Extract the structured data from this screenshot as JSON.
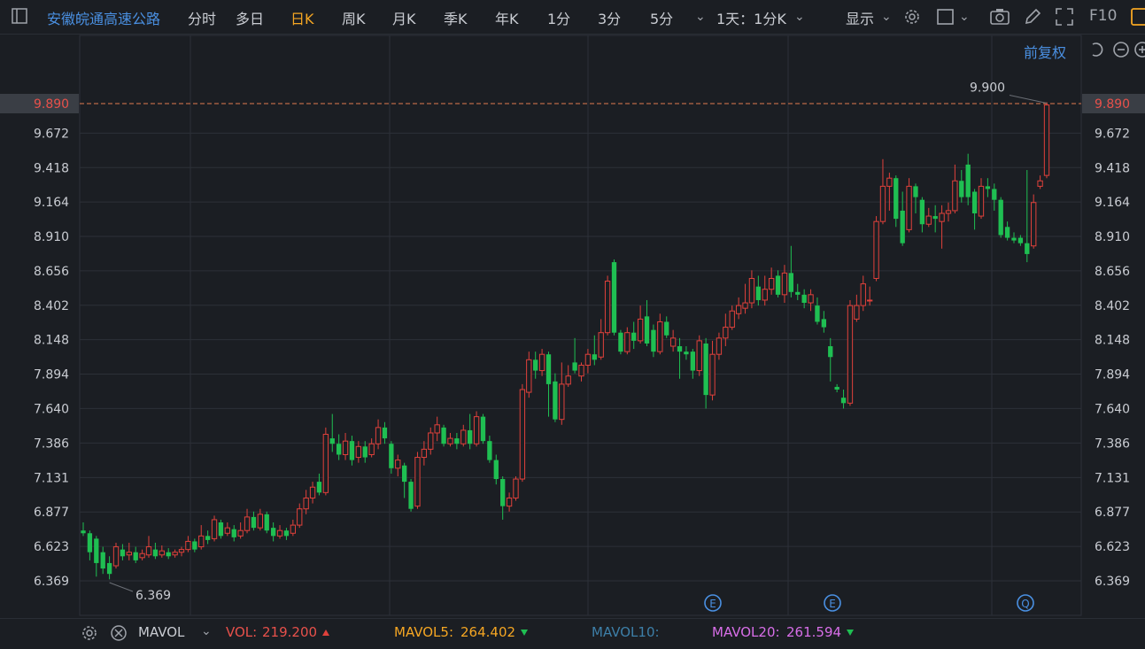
{
  "toolbar": {
    "stock_name": "安徽皖通高速公路",
    "tabs": [
      "分时",
      "多日",
      "日K",
      "周K",
      "月K",
      "季K",
      "年K",
      "1分",
      "3分",
      "5分"
    ],
    "active_tab": "日K",
    "period_select": "1天：1分K",
    "display_label": "显示",
    "f10_label": "F10"
  },
  "chart_header": {
    "adjust_label": "前复权"
  },
  "price_axis": {
    "ticks": [
      "9.890",
      "9.672",
      "9.418",
      "9.164",
      "8.910",
      "8.656",
      "8.402",
      "8.148",
      "7.894",
      "7.640",
      "7.386",
      "7.131",
      "6.877",
      "6.623",
      "6.369"
    ],
    "current_price": 9.89,
    "current_price_label": "9.890"
  },
  "annotations": {
    "high_label": "9.900",
    "low_label": "6.369",
    "event_markers": [
      "E",
      "E",
      "Q"
    ]
  },
  "chart_data": {
    "type": "candlestick",
    "ylim": [
      6.18,
      9.9
    ],
    "current_price": 9.89,
    "max_label": 9.9,
    "min_label": 6.369,
    "candles": [
      [
        6.74,
        6.72,
        6.8,
        6.7
      ],
      [
        6.72,
        6.58,
        6.74,
        6.52
      ],
      [
        6.68,
        6.5,
        6.7,
        6.4
      ],
      [
        6.58,
        6.46,
        6.62,
        6.42
      ],
      [
        6.5,
        6.42,
        6.55,
        6.38
      ],
      [
        6.48,
        6.62,
        6.65,
        6.46
      ],
      [
        6.6,
        6.55,
        6.64,
        6.52
      ],
      [
        6.56,
        6.58,
        6.65,
        6.52
      ],
      [
        6.58,
        6.52,
        6.62,
        6.5
      ],
      [
        6.54,
        6.57,
        6.6,
        6.52
      ],
      [
        6.56,
        6.62,
        6.7,
        6.54
      ],
      [
        6.6,
        6.55,
        6.65,
        6.53
      ],
      [
        6.56,
        6.59,
        6.63,
        6.54
      ],
      [
        6.58,
        6.55,
        6.61,
        6.53
      ],
      [
        6.56,
        6.58,
        6.6,
        6.54
      ],
      [
        6.58,
        6.6,
        6.62,
        6.55
      ],
      [
        6.6,
        6.66,
        6.7,
        6.58
      ],
      [
        6.66,
        6.6,
        6.68,
        6.58
      ],
      [
        6.62,
        6.7,
        6.78,
        6.6
      ],
      [
        6.7,
        6.67,
        6.74,
        6.64
      ],
      [
        6.68,
        6.82,
        6.85,
        6.66
      ],
      [
        6.8,
        6.7,
        6.82,
        6.68
      ],
      [
        6.72,
        6.76,
        6.8,
        6.7
      ],
      [
        6.75,
        6.69,
        6.78,
        6.66
      ],
      [
        6.7,
        6.74,
        6.8,
        6.68
      ],
      [
        6.74,
        6.84,
        6.9,
        6.72
      ],
      [
        6.84,
        6.76,
        6.88,
        6.74
      ],
      [
        6.76,
        6.86,
        6.9,
        6.74
      ],
      [
        6.86,
        6.74,
        6.88,
        6.72
      ],
      [
        6.76,
        6.7,
        6.8,
        6.66
      ],
      [
        6.7,
        6.74,
        6.78,
        6.68
      ],
      [
        6.74,
        6.7,
        6.76,
        6.67
      ],
      [
        6.72,
        6.78,
        6.82,
        6.7
      ],
      [
        6.78,
        6.9,
        6.94,
        6.76
      ],
      [
        6.9,
        6.98,
        7.04,
        6.86
      ],
      [
        6.98,
        7.06,
        7.1,
        6.94
      ],
      [
        7.1,
        7.02,
        7.16,
        7.0
      ],
      [
        7.02,
        7.45,
        7.5,
        7.0
      ],
      [
        7.42,
        7.38,
        7.6,
        7.32
      ],
      [
        7.38,
        7.3,
        7.45,
        7.26
      ],
      [
        7.3,
        7.4,
        7.46,
        7.26
      ],
      [
        7.4,
        7.26,
        7.44,
        7.22
      ],
      [
        7.28,
        7.36,
        7.4,
        7.24
      ],
      [
        7.36,
        7.28,
        7.4,
        7.24
      ],
      [
        7.3,
        7.38,
        7.42,
        7.28
      ],
      [
        7.38,
        7.5,
        7.56,
        7.34
      ],
      [
        7.5,
        7.42,
        7.54,
        7.38
      ],
      [
        7.38,
        7.2,
        7.4,
        7.16
      ],
      [
        7.2,
        7.26,
        7.3,
        7.14
      ],
      [
        7.22,
        7.1,
        7.24,
        6.98
      ],
      [
        7.1,
        6.9,
        7.12,
        6.88
      ],
      [
        6.92,
        7.28,
        7.32,
        6.9
      ],
      [
        7.28,
        7.34,
        7.4,
        7.22
      ],
      [
        7.34,
        7.46,
        7.5,
        7.3
      ],
      [
        7.46,
        7.52,
        7.58,
        7.4
      ],
      [
        7.5,
        7.38,
        7.52,
        7.36
      ],
      [
        7.38,
        7.42,
        7.46,
        7.36
      ],
      [
        7.42,
        7.38,
        7.46,
        7.34
      ],
      [
        7.38,
        7.48,
        7.52,
        7.36
      ],
      [
        7.48,
        7.38,
        7.6,
        7.34
      ],
      [
        7.38,
        7.58,
        7.62,
        7.36
      ],
      [
        7.58,
        7.4,
        7.6,
        7.38
      ],
      [
        7.4,
        7.26,
        7.44,
        7.24
      ],
      [
        7.26,
        7.12,
        7.3,
        7.08
      ],
      [
        7.12,
        6.92,
        7.14,
        6.82
      ],
      [
        6.92,
        6.98,
        7.02,
        6.88
      ],
      [
        6.98,
        7.12,
        7.14,
        6.96
      ],
      [
        7.12,
        7.78,
        7.82,
        7.1
      ],
      [
        7.76,
        8.0,
        8.06,
        7.72
      ],
      [
        8.0,
        7.92,
        8.06,
        7.86
      ],
      [
        7.92,
        8.04,
        8.08,
        7.88
      ],
      [
        8.04,
        7.82,
        8.06,
        7.58
      ],
      [
        7.84,
        7.56,
        7.9,
        7.54
      ],
      [
        7.56,
        7.82,
        7.98,
        7.52
      ],
      [
        7.82,
        7.88,
        7.96,
        7.8
      ],
      [
        7.98,
        7.92,
        8.16,
        7.9
      ],
      [
        7.88,
        7.96,
        7.98,
        7.84
      ],
      [
        7.96,
        8.04,
        8.08,
        7.9
      ],
      [
        8.04,
        8.0,
        8.18,
        7.96
      ],
      [
        8.02,
        8.2,
        8.3,
        8.0
      ],
      [
        8.2,
        8.58,
        8.62,
        8.18
      ],
      [
        8.72,
        8.2,
        8.74,
        8.18
      ],
      [
        8.2,
        8.06,
        8.22,
        8.04
      ],
      [
        8.06,
        8.2,
        8.24,
        8.04
      ],
      [
        8.2,
        8.14,
        8.28,
        8.08
      ],
      [
        8.14,
        8.3,
        8.4,
        8.12
      ],
      [
        8.32,
        8.12,
        8.44,
        8.1
      ],
      [
        8.22,
        8.06,
        8.26,
        8.02
      ],
      [
        8.06,
        8.28,
        8.34,
        8.04
      ],
      [
        8.28,
        8.18,
        8.32,
        8.16
      ],
      [
        8.1,
        8.16,
        8.22,
        8.06
      ],
      [
        8.1,
        8.06,
        8.16,
        7.86
      ],
      [
        8.06,
        8.04,
        8.1,
        8.0
      ],
      [
        8.06,
        7.92,
        8.08,
        7.86
      ],
      [
        7.92,
        8.14,
        8.18,
        7.88
      ],
      [
        8.12,
        7.74,
        8.16,
        7.64
      ],
      [
        7.74,
        8.04,
        8.14,
        7.7
      ],
      [
        8.04,
        8.16,
        8.2,
        8.0
      ],
      [
        8.16,
        8.24,
        8.34,
        8.1
      ],
      [
        8.24,
        8.36,
        8.4,
        8.22
      ],
      [
        8.34,
        8.4,
        8.46,
        8.3
      ],
      [
        8.38,
        8.42,
        8.56,
        8.34
      ],
      [
        8.42,
        8.6,
        8.66,
        8.38
      ],
      [
        8.54,
        8.44,
        8.62,
        8.4
      ],
      [
        8.44,
        8.52,
        8.62,
        8.4
      ],
      [
        8.52,
        8.6,
        8.68,
        8.48
      ],
      [
        8.62,
        8.48,
        8.66,
        8.46
      ],
      [
        8.48,
        8.64,
        8.7,
        8.42
      ],
      [
        8.64,
        8.5,
        8.84,
        8.46
      ],
      [
        8.5,
        8.48,
        8.56,
        8.44
      ],
      [
        8.48,
        8.42,
        8.52,
        8.38
      ],
      [
        8.42,
        8.48,
        8.52,
        8.36
      ],
      [
        8.4,
        8.28,
        8.46,
        8.26
      ],
      [
        8.3,
        8.24,
        8.36,
        8.2
      ],
      [
        8.1,
        8.02,
        8.16,
        7.84
      ],
      [
        7.8,
        7.78,
        7.82,
        7.76
      ],
      [
        7.72,
        7.68,
        7.78,
        7.64
      ],
      [
        7.68,
        8.4,
        8.44,
        7.66
      ],
      [
        8.3,
        8.4,
        8.48,
        8.28
      ],
      [
        8.4,
        8.56,
        8.62,
        8.36
      ],
      [
        8.44,
        8.44,
        8.54,
        8.4
      ],
      [
        8.6,
        9.02,
        9.06,
        8.58
      ],
      [
        9.02,
        9.28,
        9.48,
        9.0
      ],
      [
        9.28,
        9.34,
        9.38,
        9.1
      ],
      [
        9.34,
        9.04,
        9.36,
        8.98
      ],
      [
        9.1,
        8.86,
        9.24,
        8.84
      ],
      [
        8.96,
        9.28,
        9.34,
        8.94
      ],
      [
        9.28,
        9.2,
        9.3,
        9.08
      ],
      [
        9.18,
        9.0,
        9.2,
        8.94
      ],
      [
        9.0,
        9.06,
        9.12,
        8.98
      ],
      [
        9.06,
        9.04,
        9.14,
        8.94
      ],
      [
        9.02,
        9.08,
        9.14,
        8.82
      ],
      [
        9.08,
        9.1,
        9.16,
        9.02
      ],
      [
        9.1,
        9.32,
        9.44,
        9.08
      ],
      [
        9.32,
        9.2,
        9.4,
        9.16
      ],
      [
        9.44,
        9.2,
        9.52,
        9.14
      ],
      [
        9.24,
        9.08,
        9.26,
        8.96
      ],
      [
        9.06,
        9.28,
        9.34,
        9.04
      ],
      [
        9.28,
        9.26,
        9.34,
        9.2
      ],
      [
        9.26,
        9.18,
        9.3,
        9.1
      ],
      [
        9.18,
        8.92,
        9.2,
        8.9
      ],
      [
        8.98,
        8.9,
        9.02,
        8.88
      ],
      [
        8.9,
        8.88,
        8.94,
        8.86
      ],
      [
        8.9,
        8.86,
        8.92,
        8.84
      ],
      [
        8.86,
        8.78,
        9.4,
        8.72
      ],
      [
        8.84,
        9.16,
        9.22,
        8.82
      ],
      [
        9.28,
        9.32,
        9.36,
        9.26
      ],
      [
        9.36,
        9.88,
        9.9,
        9.34
      ]
    ]
  },
  "bottom_bar": {
    "indicator": "MAVOL",
    "vol_label": "VOL:",
    "vol_value": "219.200",
    "mavol5_label": "MAVOL5:",
    "mavol5_value": "264.402",
    "mavol10_label": "MAVOL10:",
    "mavol20_label": "MAVOL20:",
    "mavol20_value": "261.594"
  },
  "colors": {
    "up": "#e0413b",
    "down": "#1fbf52",
    "accent": "#f5a623",
    "link": "#4a90e2",
    "vol": "#e8514b",
    "mavol5": "#f5a623",
    "mavol10": "#3d7fa8",
    "mavol20": "#d86ee8"
  }
}
